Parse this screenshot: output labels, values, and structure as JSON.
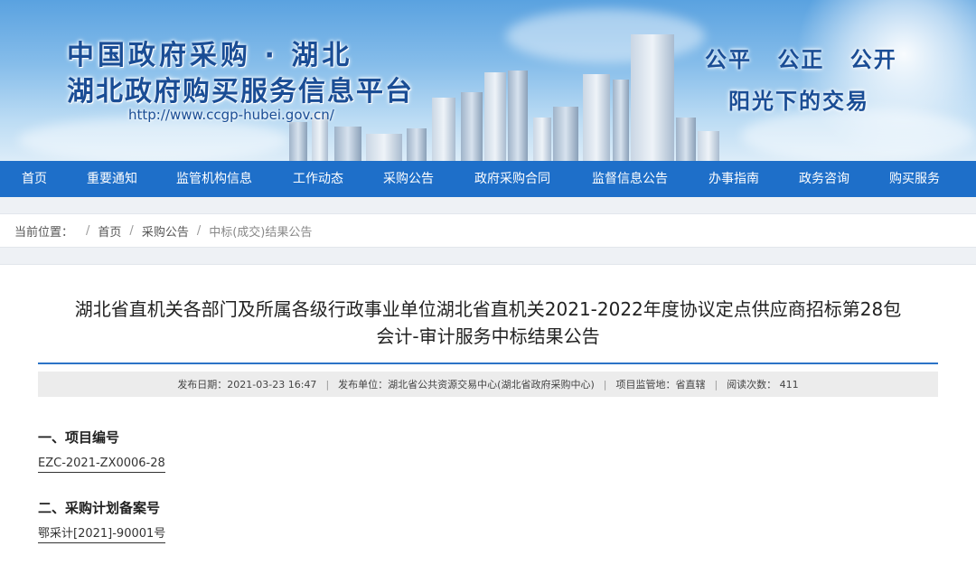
{
  "header": {
    "title_line1": "中国政府采购 · 湖北",
    "title_line2": "湖北政府购买服务信息平台",
    "url": "http://www.ccgp-hubei.gov.cn/",
    "slogan_line1": "公平 公正 公开",
    "slogan_line2": "阳光下的交易"
  },
  "nav": {
    "items": [
      {
        "label": "首页"
      },
      {
        "label": "重要通知"
      },
      {
        "label": "监管机构信息"
      },
      {
        "label": "工作动态"
      },
      {
        "label": "采购公告"
      },
      {
        "label": "政府采购合同"
      },
      {
        "label": "监督信息公告"
      },
      {
        "label": "办事指南"
      },
      {
        "label": "政务咨询"
      },
      {
        "label": "购买服务"
      }
    ]
  },
  "breadcrumb": {
    "prefix": "当前位置：",
    "items": [
      "首页",
      "采购公告",
      "中标(成交)结果公告"
    ]
  },
  "article": {
    "title_line1": "湖北省直机关各部门及所属各级行政事业单位湖北省直机关2021-2022年度协议定点供应商招标第28包",
    "title_line2": "会计-审计服务中标结果公告",
    "meta": {
      "publish_date": "发布日期：2021-03-23 16:47",
      "publisher": "发布单位：湖北省公共资源交易中心(湖北省政府采购中心)",
      "supervision": "项目监管地：省直辖",
      "views": "阅读次数： 411"
    },
    "sections": [
      {
        "heading": "一、项目编号",
        "value": "EZC-2021-ZX0006-28"
      },
      {
        "heading": "二、采购计划备案号",
        "value": "鄂采计[2021]-90001号"
      }
    ]
  },
  "colors": {
    "nav_bg": "#1e6fc9",
    "title_blue": "#1a4d95",
    "rule_blue": "#2c74c7"
  }
}
